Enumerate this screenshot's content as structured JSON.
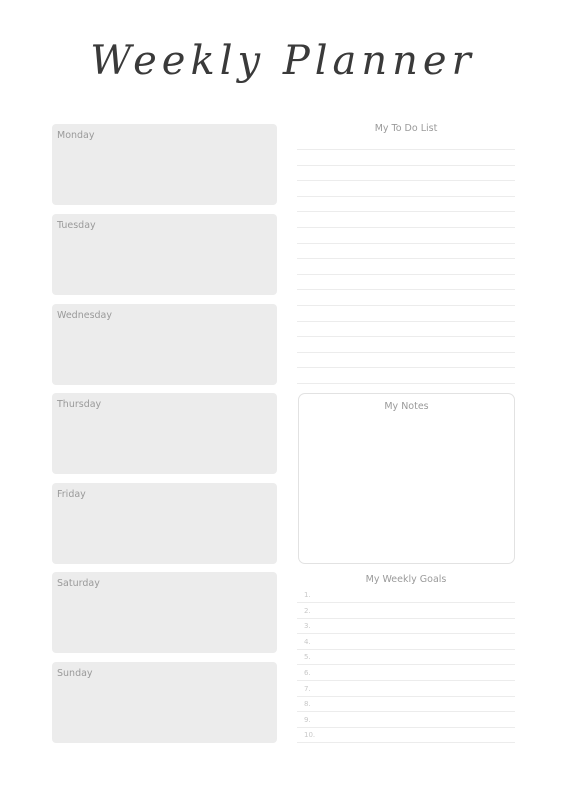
{
  "header": {
    "title": "Weekly Planner"
  },
  "days": [
    {
      "label": "Monday"
    },
    {
      "label": "Tuesday"
    },
    {
      "label": "Wednesday"
    },
    {
      "label": "Thursday"
    },
    {
      "label": "Friday"
    },
    {
      "label": "Saturday"
    },
    {
      "label": "Sunday"
    }
  ],
  "todo": {
    "title": "My To Do List",
    "line_count": 16
  },
  "notes": {
    "title": "My Notes"
  },
  "goals": {
    "title": "My Weekly Goals",
    "items": [
      "1.",
      "2.",
      "3.",
      "4.",
      "5.",
      "6.",
      "7.",
      "8.",
      "9.",
      "10."
    ]
  },
  "colors": {
    "day_box": "#ececec",
    "label_text": "#9a9a9a",
    "title_text": "#3a3a3a",
    "rule": "#ececec"
  }
}
